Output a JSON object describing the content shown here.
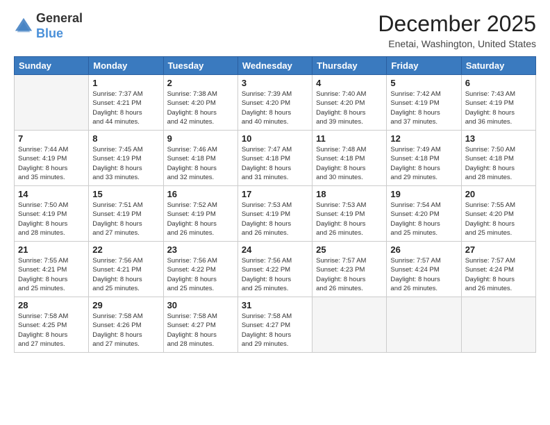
{
  "logo": {
    "line1": "General",
    "line2": "Blue"
  },
  "title": "December 2025",
  "location": "Enetai, Washington, United States",
  "weekdays": [
    "Sunday",
    "Monday",
    "Tuesday",
    "Wednesday",
    "Thursday",
    "Friday",
    "Saturday"
  ],
  "weeks": [
    [
      {
        "day": "",
        "sunrise": "",
        "sunset": "",
        "daylight": ""
      },
      {
        "day": "1",
        "sunrise": "Sunrise: 7:37 AM",
        "sunset": "Sunset: 4:21 PM",
        "daylight": "Daylight: 8 hours and 44 minutes."
      },
      {
        "day": "2",
        "sunrise": "Sunrise: 7:38 AM",
        "sunset": "Sunset: 4:20 PM",
        "daylight": "Daylight: 8 hours and 42 minutes."
      },
      {
        "day": "3",
        "sunrise": "Sunrise: 7:39 AM",
        "sunset": "Sunset: 4:20 PM",
        "daylight": "Daylight: 8 hours and 40 minutes."
      },
      {
        "day": "4",
        "sunrise": "Sunrise: 7:40 AM",
        "sunset": "Sunset: 4:20 PM",
        "daylight": "Daylight: 8 hours and 39 minutes."
      },
      {
        "day": "5",
        "sunrise": "Sunrise: 7:42 AM",
        "sunset": "Sunset: 4:19 PM",
        "daylight": "Daylight: 8 hours and 37 minutes."
      },
      {
        "day": "6",
        "sunrise": "Sunrise: 7:43 AM",
        "sunset": "Sunset: 4:19 PM",
        "daylight": "Daylight: 8 hours and 36 minutes."
      }
    ],
    [
      {
        "day": "7",
        "sunrise": "Sunrise: 7:44 AM",
        "sunset": "Sunset: 4:19 PM",
        "daylight": "Daylight: 8 hours and 35 minutes."
      },
      {
        "day": "8",
        "sunrise": "Sunrise: 7:45 AM",
        "sunset": "Sunset: 4:19 PM",
        "daylight": "Daylight: 8 hours and 33 minutes."
      },
      {
        "day": "9",
        "sunrise": "Sunrise: 7:46 AM",
        "sunset": "Sunset: 4:18 PM",
        "daylight": "Daylight: 8 hours and 32 minutes."
      },
      {
        "day": "10",
        "sunrise": "Sunrise: 7:47 AM",
        "sunset": "Sunset: 4:18 PM",
        "daylight": "Daylight: 8 hours and 31 minutes."
      },
      {
        "day": "11",
        "sunrise": "Sunrise: 7:48 AM",
        "sunset": "Sunset: 4:18 PM",
        "daylight": "Daylight: 8 hours and 30 minutes."
      },
      {
        "day": "12",
        "sunrise": "Sunrise: 7:49 AM",
        "sunset": "Sunset: 4:18 PM",
        "daylight": "Daylight: 8 hours and 29 minutes."
      },
      {
        "day": "13",
        "sunrise": "Sunrise: 7:50 AM",
        "sunset": "Sunset: 4:18 PM",
        "daylight": "Daylight: 8 hours and 28 minutes."
      }
    ],
    [
      {
        "day": "14",
        "sunrise": "Sunrise: 7:50 AM",
        "sunset": "Sunset: 4:19 PM",
        "daylight": "Daylight: 8 hours and 28 minutes."
      },
      {
        "day": "15",
        "sunrise": "Sunrise: 7:51 AM",
        "sunset": "Sunset: 4:19 PM",
        "daylight": "Daylight: 8 hours and 27 minutes."
      },
      {
        "day": "16",
        "sunrise": "Sunrise: 7:52 AM",
        "sunset": "Sunset: 4:19 PM",
        "daylight": "Daylight: 8 hours and 26 minutes."
      },
      {
        "day": "17",
        "sunrise": "Sunrise: 7:53 AM",
        "sunset": "Sunset: 4:19 PM",
        "daylight": "Daylight: 8 hours and 26 minutes."
      },
      {
        "day": "18",
        "sunrise": "Sunrise: 7:53 AM",
        "sunset": "Sunset: 4:19 PM",
        "daylight": "Daylight: 8 hours and 26 minutes."
      },
      {
        "day": "19",
        "sunrise": "Sunrise: 7:54 AM",
        "sunset": "Sunset: 4:20 PM",
        "daylight": "Daylight: 8 hours and 25 minutes."
      },
      {
        "day": "20",
        "sunrise": "Sunrise: 7:55 AM",
        "sunset": "Sunset: 4:20 PM",
        "daylight": "Daylight: 8 hours and 25 minutes."
      }
    ],
    [
      {
        "day": "21",
        "sunrise": "Sunrise: 7:55 AM",
        "sunset": "Sunset: 4:21 PM",
        "daylight": "Daylight: 8 hours and 25 minutes."
      },
      {
        "day": "22",
        "sunrise": "Sunrise: 7:56 AM",
        "sunset": "Sunset: 4:21 PM",
        "daylight": "Daylight: 8 hours and 25 minutes."
      },
      {
        "day": "23",
        "sunrise": "Sunrise: 7:56 AM",
        "sunset": "Sunset: 4:22 PM",
        "daylight": "Daylight: 8 hours and 25 minutes."
      },
      {
        "day": "24",
        "sunrise": "Sunrise: 7:56 AM",
        "sunset": "Sunset: 4:22 PM",
        "daylight": "Daylight: 8 hours and 25 minutes."
      },
      {
        "day": "25",
        "sunrise": "Sunrise: 7:57 AM",
        "sunset": "Sunset: 4:23 PM",
        "daylight": "Daylight: 8 hours and 26 minutes."
      },
      {
        "day": "26",
        "sunrise": "Sunrise: 7:57 AM",
        "sunset": "Sunset: 4:24 PM",
        "daylight": "Daylight: 8 hours and 26 minutes."
      },
      {
        "day": "27",
        "sunrise": "Sunrise: 7:57 AM",
        "sunset": "Sunset: 4:24 PM",
        "daylight": "Daylight: 8 hours and 26 minutes."
      }
    ],
    [
      {
        "day": "28",
        "sunrise": "Sunrise: 7:58 AM",
        "sunset": "Sunset: 4:25 PM",
        "daylight": "Daylight: 8 hours and 27 minutes."
      },
      {
        "day": "29",
        "sunrise": "Sunrise: 7:58 AM",
        "sunset": "Sunset: 4:26 PM",
        "daylight": "Daylight: 8 hours and 27 minutes."
      },
      {
        "day": "30",
        "sunrise": "Sunrise: 7:58 AM",
        "sunset": "Sunset: 4:27 PM",
        "daylight": "Daylight: 8 hours and 28 minutes."
      },
      {
        "day": "31",
        "sunrise": "Sunrise: 7:58 AM",
        "sunset": "Sunset: 4:27 PM",
        "daylight": "Daylight: 8 hours and 29 minutes."
      },
      {
        "day": "",
        "sunrise": "",
        "sunset": "",
        "daylight": ""
      },
      {
        "day": "",
        "sunrise": "",
        "sunset": "",
        "daylight": ""
      },
      {
        "day": "",
        "sunrise": "",
        "sunset": "",
        "daylight": ""
      }
    ]
  ]
}
